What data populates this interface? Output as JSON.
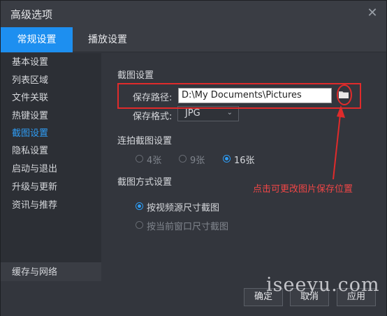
{
  "window": {
    "title": "高级选项",
    "close_symbol": "✕"
  },
  "tabs": [
    {
      "label": "常规设置",
      "active": true
    },
    {
      "label": "播放设置",
      "active": false
    }
  ],
  "sidebar": {
    "items": [
      {
        "label": "基本设置"
      },
      {
        "label": "列表区域"
      },
      {
        "label": "文件关联"
      },
      {
        "label": "热键设置"
      },
      {
        "label": "截图设置",
        "active": true
      },
      {
        "label": "隐私设置"
      },
      {
        "label": "启动与退出"
      },
      {
        "label": "升级与更新"
      },
      {
        "label": "资讯与推荐"
      }
    ],
    "bottom_item": "缓存与网络"
  },
  "screenshot_settings": {
    "section_title": "截图设置",
    "save_path_label": "保存路径:",
    "save_path_value": "D:\\My Documents\\Pictures",
    "save_format_label": "保存格式:",
    "save_format_value": "JPG"
  },
  "burst_settings": {
    "section_title": "连拍截图设置",
    "options": [
      {
        "label": "4张",
        "selected": false
      },
      {
        "label": "9张",
        "selected": false
      },
      {
        "label": "16张",
        "selected": true
      }
    ]
  },
  "mode_settings": {
    "section_title": "截图方式设置",
    "options": [
      {
        "label": "按视频源尺寸截图",
        "selected": true
      },
      {
        "label": "按当前窗口尺寸截图",
        "selected": false
      }
    ]
  },
  "annotation": {
    "text": "点击可更改图片保存位置",
    "color": "#e02b2b"
  },
  "footer": {
    "ok_label": "确定",
    "cancel_label": "取消",
    "apply_label": "应用"
  },
  "watermark": "iseeyu.com",
  "colors": {
    "accent": "#1d8ff0",
    "annotation": "#e02b2b"
  }
}
